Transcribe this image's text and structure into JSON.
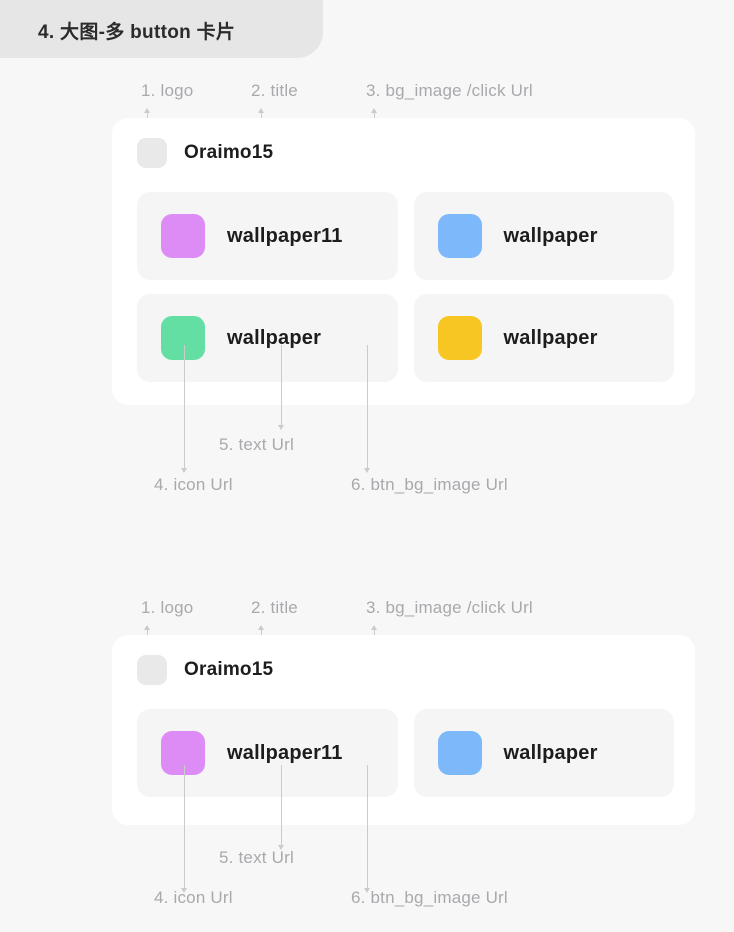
{
  "section": {
    "title": "4. 大图-多 button 卡片"
  },
  "annotations": {
    "logo": "1. logo",
    "title": "2. title",
    "bg_image": "3. bg_image /click Url",
    "icon_url": "4. icon Url",
    "text_url": "5. text Url",
    "btn_bg_image_url": "6. btn_bg_image Url"
  },
  "colors": {
    "page_bg": "#f7f7f7",
    "tab_bg": "#e6e6e6",
    "card_bg": "#ffffff",
    "button_bg": "#f5f5f5",
    "logo_bg": "#e9e9e9",
    "leader_line": "#c9cbcd",
    "annotation_text": "#a7a9ac",
    "title_text": "#1d1d1f",
    "icon_purple": "#dd8bf5",
    "icon_blue": "#7db8fb",
    "icon_green": "#63dfa3",
    "icon_yellow": "#f8c623"
  },
  "cards": [
    {
      "title": "Oraimo15",
      "buttons": [
        {
          "label": "wallpaper11",
          "icon_color": "#dd8bf5",
          "icon_name": "wallpaper-swatch-purple"
        },
        {
          "label": "wallpaper",
          "icon_color": "#7db8fb",
          "icon_name": "wallpaper-swatch-blue"
        },
        {
          "label": "wallpaper",
          "icon_color": "#63dfa3",
          "icon_name": "wallpaper-swatch-green"
        },
        {
          "label": "wallpaper",
          "icon_color": "#f8c623",
          "icon_name": "wallpaper-swatch-yellow"
        }
      ]
    },
    {
      "title": "Oraimo15",
      "buttons": [
        {
          "label": "wallpaper11",
          "icon_color": "#dd8bf5",
          "icon_name": "wallpaper-swatch-purple"
        },
        {
          "label": "wallpaper",
          "icon_color": "#7db8fb",
          "icon_name": "wallpaper-swatch-blue"
        }
      ]
    }
  ]
}
